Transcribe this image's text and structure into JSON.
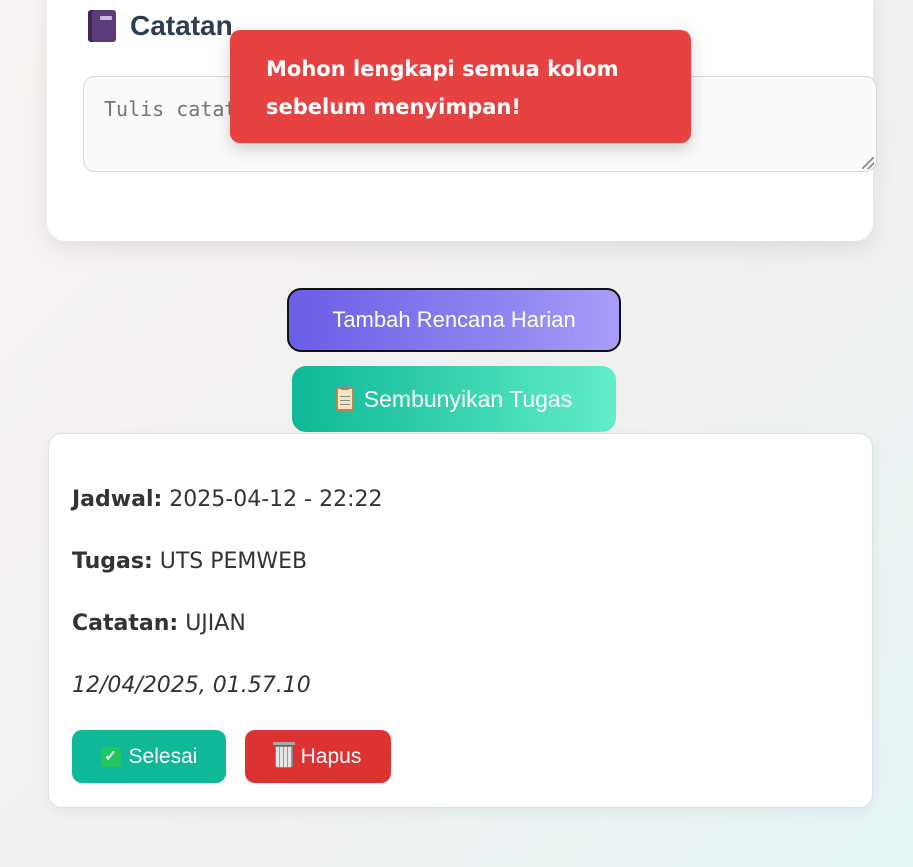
{
  "form": {
    "section_title": "Catatan",
    "section_icon": "book-icon",
    "notes_placeholder": "Tulis catatan..."
  },
  "toast": {
    "message": "Mohon lengkapi semua kolom sebelum menyimpan!"
  },
  "actions": {
    "add_label": "Tambah Rencana Harian",
    "toggle_label": "Sembunyikan Tugas",
    "toggle_icon": "clipboard-icon"
  },
  "task": {
    "schedule_label": "Jadwal:",
    "schedule_value": "2025-04-12 - 22:22",
    "task_label": "Tugas:",
    "task_value": "UTS PEMWEB",
    "notes_label": "Catatan:",
    "notes_value": "UJIAN",
    "timestamp": "12/04/2025, 01.57.10",
    "done_label": "Selesai",
    "delete_label": "Hapus"
  },
  "colors": {
    "toast_bg": "#e64242",
    "done_bg": "#0fb896",
    "delete_bg": "#dc3232",
    "add_gradient_start": "#6a5ee6",
    "toggle_gradient_start": "#0fb896"
  }
}
